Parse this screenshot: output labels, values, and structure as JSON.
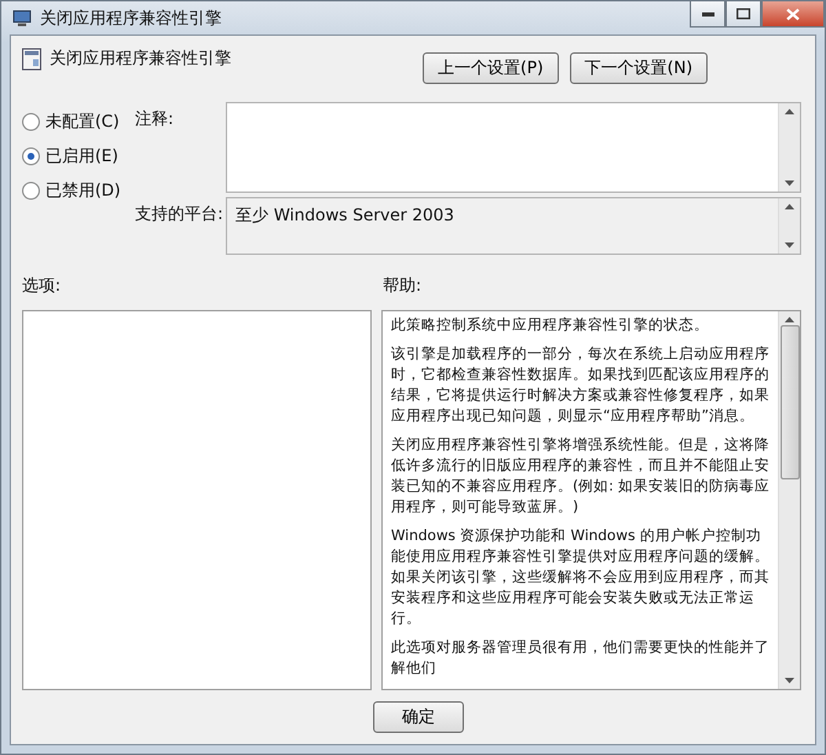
{
  "window": {
    "title": "关闭应用程序兼容性引擎"
  },
  "header": {
    "title": "关闭应用程序兼容性引擎",
    "buttons": [
      {
        "label": "上一个设置(P)"
      },
      {
        "label": "下一个设置(N)"
      }
    ]
  },
  "state_options": [
    {
      "label": "未配置(C)",
      "selected": false
    },
    {
      "label": "已启用(E)",
      "selected": true
    },
    {
      "label": "已禁用(D)",
      "selected": false
    }
  ],
  "comment": {
    "label": "注释:"
  },
  "platform": {
    "label": "支持的平台:",
    "value": "至少 Windows Server 2003"
  },
  "options": {
    "label": "选项:"
  },
  "help": {
    "label": "帮助:",
    "paragraphs": [
      "此策略控制系统中应用程序兼容性引擎的状态。",
      "该引擎是加载程序的一部分，每次在系统上启动应用程序时，它都检查兼容性数据库。如果找到匹配该应用程序的结果，它将提供运行时解决方案或兼容性修复程序，如果应用程序出现已知问题，则显示“应用程序帮助”消息。",
      "关闭应用程序兼容性引擎将增强系统性能。但是，这将降低许多流行的旧版应用程序的兼容性，而且并不能阻止安装已知的不兼容应用程序。(例如: 如果安装旧的防病毒应用程序，则可能导致蓝屏。)",
      "Windows 资源保护功能和 Windows 的用户帐户控制功能使用应用程序兼容性引擎提供对应用程序问题的缓解。如果关闭该引擎，这些缓解将不会应用到应用程序，而其安装程序和这些应用程序可能会安装失败或无法正常运行。",
      "此选项对服务器管理员很有用，他们需要更快的性能并了解他们"
    ]
  },
  "footer": {
    "buttons": [
      {
        "label": "确定"
      }
    ]
  }
}
